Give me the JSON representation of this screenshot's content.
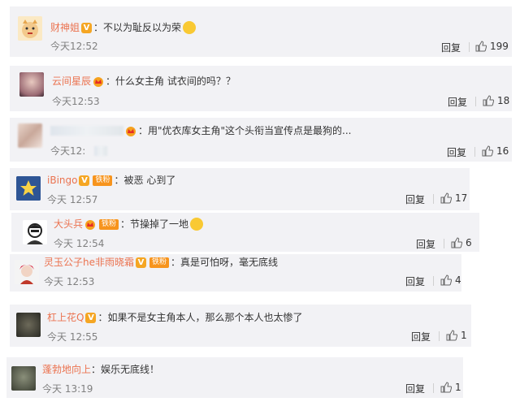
{
  "colors": {
    "username": "#eb7350",
    "card_bg": "#f2f2f5",
    "vip_badge": "#f5a623"
  },
  "comments": [
    {
      "user": "财神姐",
      "badge": "V",
      "text": "不以为耻反以为荣",
      "emoji": "grin-emoji",
      "time": "今天12:52",
      "reply": "回复",
      "likes": "199"
    },
    {
      "user": "云间星辰",
      "badge": "crown",
      "text": "什么女主角 试衣间的吗？？",
      "time": "今天12:53",
      "reply": "回复",
      "likes": "18"
    },
    {
      "user": "",
      "badge": "crown",
      "text": "用\"优衣库女主角\"这个头衔当宣传点是最狗的...",
      "time": "今天12:",
      "reply": "回复",
      "likes": "16"
    },
    {
      "user": "iBingo",
      "badge": "V",
      "tag": "铁粉",
      "text": "被恶 心到了",
      "time": "今天 12:57",
      "reply": "回复",
      "likes": "17"
    },
    {
      "user": "大头兵",
      "badge": "crown",
      "tag": "铁粉",
      "text": "节操掉了一地",
      "emoji": "laugh-emoji",
      "time": "今天 12:54",
      "reply": "回复",
      "likes": "6"
    },
    {
      "user": "灵玉公子he非雨晓霜",
      "badge": "V",
      "tag": "铁粉",
      "text": "真是可怕呀，毫无底线",
      "time": "今天 12:53",
      "reply": "回复",
      "likes": "4"
    },
    {
      "user": "杠上花Q",
      "badge": "V",
      "text": "如果不是女主角本人，那么那个本人也太惨了",
      "time": "今天 12:55",
      "reply": "回复",
      "likes": "1"
    },
    {
      "user": "蓬勃地向上",
      "text": "娱乐无底线！",
      "time": "今天 13:19",
      "reply": "回复",
      "likes": "1"
    }
  ]
}
